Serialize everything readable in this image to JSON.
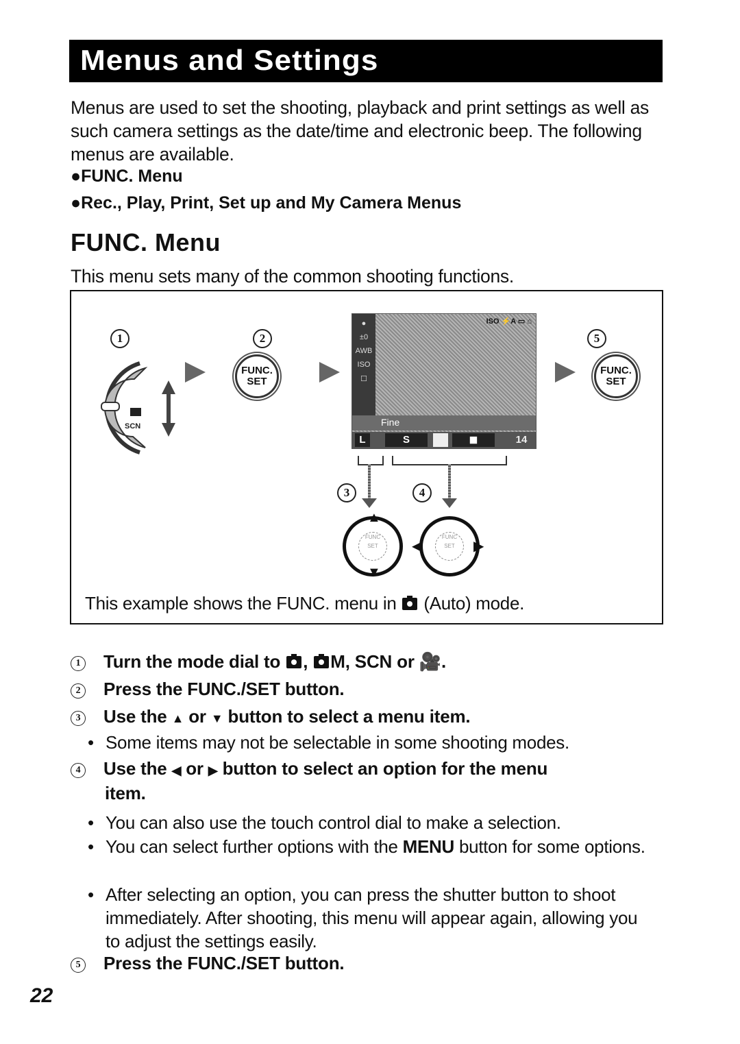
{
  "header": {
    "title": "Menus and Settings"
  },
  "intro": {
    "paragraph": "Menus are used to set the shooting, playback and print settings as well as such camera settings as the date/time and electronic beep. The following menus are available.",
    "bullets": [
      "●FUNC. Menu",
      "●Rec., Play, Print, Set up and My Camera Menus"
    ]
  },
  "section": {
    "title": "FUNC. Menu",
    "subtitle": "This menu sets many of the common shooting functions."
  },
  "figure": {
    "callouts": [
      "1",
      "2",
      "3",
      "4",
      "5"
    ],
    "func_button": {
      "line1": "FUNC.",
      "line2": "SET"
    },
    "screen": {
      "left_icons": [
        "●",
        "±0",
        "AWB",
        "ISO",
        "☐"
      ],
      "top_icons": "ISO  ⚡A  ▭  ⌂",
      "selected_label": "Fine",
      "options": [
        "L",
        "S",
        "◢",
        "◼"
      ],
      "shots_remaining": "14"
    },
    "caption_pre": "This example shows the FUNC. menu in",
    "caption_post": "(Auto) mode."
  },
  "steps": [
    {
      "num": "1",
      "text": "Turn the mode dial to",
      "suffix_m": "M, SCN",
      "suffix_or": "or",
      "suffix_end": "."
    },
    {
      "num": "2",
      "text": "Press the FUNC./SET button."
    },
    {
      "num": "3",
      "text_a": "Use the",
      "arrow_a": "▲",
      "text_b": "or",
      "arrow_b": "▼",
      "text_c": "button to select a menu item.",
      "notes": [
        "Some items may not be selectable in some shooting modes."
      ]
    },
    {
      "num": "4",
      "text_a": "Use the",
      "arrow_a": "◀",
      "text_b": "or",
      "arrow_b": "▶",
      "text_c": "button to select an option for the menu",
      "text_d": "item.",
      "notes": [
        "You can also use the touch control dial to make a selection.",
        {
          "pre": "You can select further options with the ",
          "bold": "MENU",
          "post": " button for some options."
        },
        "After selecting an option, you can press the shutter button to shoot immediately. After shooting, this menu will appear again, allowing you to adjust the settings easily."
      ]
    },
    {
      "num": "5",
      "text": "Press the FUNC./SET button."
    }
  ],
  "footer": {
    "page_number": "22"
  }
}
